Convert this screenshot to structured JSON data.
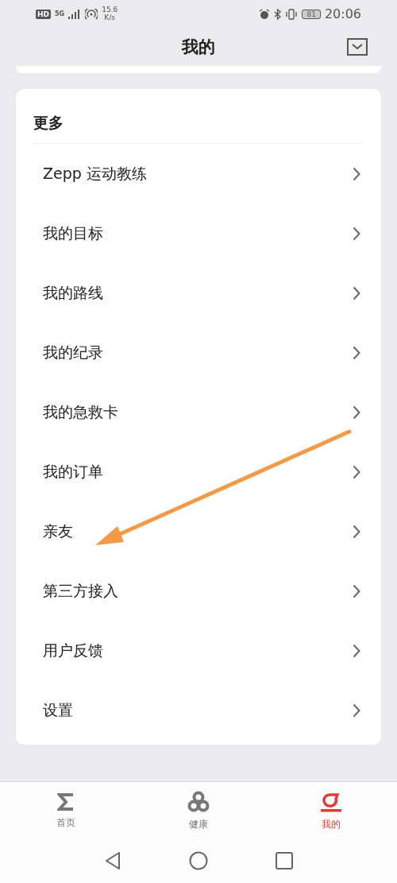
{
  "status_bar": {
    "hd": "HD",
    "network": "5G",
    "speed": "15.6",
    "speed_unit": "K/s",
    "battery": "81",
    "time": "20:06"
  },
  "header": {
    "title": "我的"
  },
  "section": {
    "title": "更多",
    "items": [
      {
        "label": "Zepp 运动教练"
      },
      {
        "label": "我的目标"
      },
      {
        "label": "我的路线"
      },
      {
        "label": "我的纪录"
      },
      {
        "label": "我的急救卡"
      },
      {
        "label": "我的订单"
      },
      {
        "label": "亲友"
      },
      {
        "label": "第三方接入"
      },
      {
        "label": "用户反馈"
      },
      {
        "label": "设置"
      }
    ]
  },
  "tabs": [
    {
      "label": "首页",
      "kind": "sigma",
      "selected": false
    },
    {
      "label": "健康",
      "kind": "trefoil",
      "selected": false
    },
    {
      "label": "我的",
      "kind": "me",
      "selected": true
    }
  ]
}
